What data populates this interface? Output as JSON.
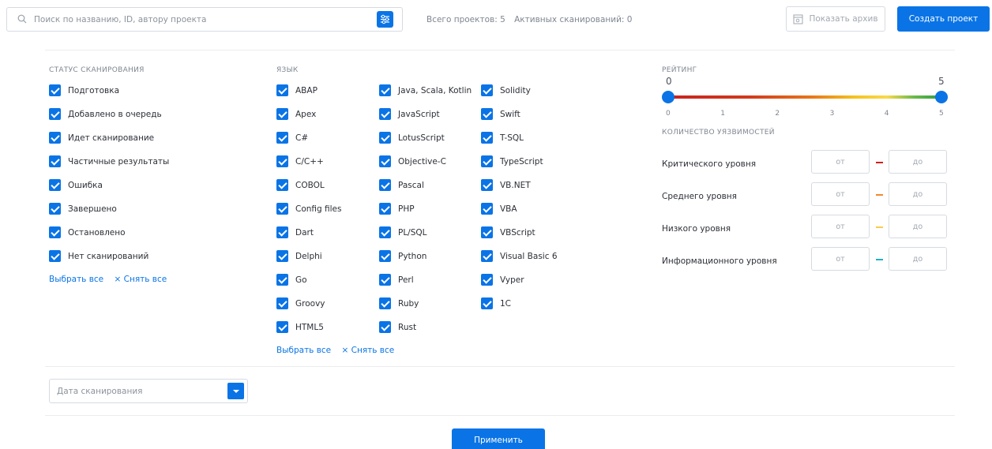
{
  "search": {
    "placeholder": "Поиск по названию, ID, автору проекта",
    "icon": "search-icon",
    "filter_icon": "sliders-icon"
  },
  "stats": {
    "total": "Всего проектов: 5",
    "active": "Активных сканирований: 0"
  },
  "archive_button": {
    "label": "Показать архив",
    "icon": "archive-icon"
  },
  "create_button": {
    "label": "Создать проект"
  },
  "status": {
    "title": "СТАТУС СКАНИРОВАНИЯ",
    "items": [
      "Подготовка",
      "Добавлено в очередь",
      "Идет сканирование",
      "Частичные результаты",
      "Ошибка",
      "Завершено",
      "Остановлено",
      "Нет сканирований"
    ],
    "select_all": "Выбрать все",
    "clear_all": "× Снять все"
  },
  "language": {
    "title": "ЯЗЫК",
    "col1": [
      "ABAP",
      "Apex",
      "C#",
      "C/C++",
      "COBOL",
      "Config files",
      "Dart",
      "Delphi",
      "Go",
      "Groovy",
      "HTML5"
    ],
    "col2": [
      "Java, Scala, Kotlin",
      "JavaScript",
      "LotusScript",
      "Objective-C",
      "Pascal",
      "PHP",
      "PL/SQL",
      "Python",
      "Perl",
      "Ruby",
      "Rust"
    ],
    "col3": [
      "Solidity",
      "Swift",
      "T-SQL",
      "TypeScript",
      "VB.NET",
      "VBA",
      "VBScript",
      "Visual Basic 6",
      "Vyper",
      "1C"
    ],
    "select_all": "Выбрать все",
    "clear_all": "× Снять все"
  },
  "rating": {
    "title": "РЕЙТИНГ",
    "min_value": "0",
    "max_value": "5",
    "selected_min": 0,
    "selected_max": 5,
    "ticks": [
      "0",
      "1",
      "2",
      "3",
      "4",
      "5"
    ]
  },
  "vulns": {
    "title": "КОЛИЧЕСТВО УЯЗВИМОСТЕЙ",
    "from_placeholder": "от",
    "to_placeholder": "до",
    "levels": [
      {
        "label": "Критического уровня",
        "color": "#d0201c"
      },
      {
        "label": "Среднего уровня",
        "color": "#f08a2c"
      },
      {
        "label": "Низкого уровня",
        "color": "#f7cd4a"
      },
      {
        "label": "Информационного уровня",
        "color": "#1fb1c4"
      }
    ]
  },
  "date": {
    "placeholder": "Дата сканирования"
  },
  "apply_button": {
    "label": "Применить"
  },
  "colors": {
    "accent": "#0a74e6"
  }
}
